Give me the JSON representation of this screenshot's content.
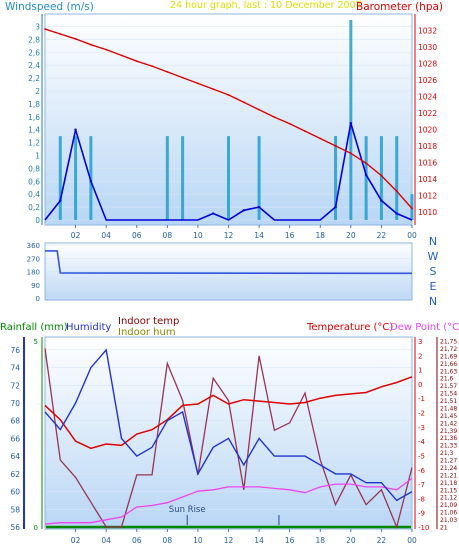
{
  "panel_top": {
    "left_label": "Windspeed (m/s)",
    "center_label": "24 hour graph, last : 10 December 2007",
    "right_label": "Barometer (hpa)",
    "windspeed_ticks": [
      "0",
      "0,2",
      "0,4",
      "0,6",
      "0,8",
      "1",
      "1,2",
      "1,4",
      "1,6",
      "1,8",
      "2",
      "2,2",
      "2,4",
      "2,6",
      "2,8",
      "3"
    ],
    "barometer_ticks": [
      "1010",
      "1012",
      "1014",
      "1016",
      "1018",
      "1020",
      "1022",
      "1024",
      "1026",
      "1028",
      "1030",
      "1032"
    ],
    "colors": {
      "barometer": "#dd0000",
      "gust": "#1f9fcf",
      "speed": "#0000dd",
      "green": "#00aa00"
    }
  },
  "panel_dir": {
    "ticks": [
      "0",
      "90",
      "180",
      "270",
      "360"
    ],
    "compass": [
      "N",
      "W",
      "S",
      "E",
      "N"
    ],
    "color": "#3355dd"
  },
  "panel_bottom": {
    "labels": {
      "rainfall": "Rainfall (mm)",
      "humidity": "Humidity",
      "indoor_temp": "Indoor temp",
      "indoor_hum": "Indoor hum",
      "temperature": "Temperature (°C)",
      "dew_point": "Dew Point (°C)"
    },
    "left_ticks": [
      "58",
      "60",
      "62",
      "64",
      "66",
      "68",
      "70",
      "72",
      "74",
      "76"
    ],
    "rain_ticks": [
      "0",
      "5"
    ],
    "temp_ticks": [
      "-10",
      "-9",
      "-8",
      "-7",
      "-6",
      "-5",
      "-4",
      "-3",
      "-2",
      "-1",
      "0",
      "1",
      "2",
      "3"
    ],
    "indoor_ticks": [
      "21",
      "21,03",
      "21,06",
      "21,09",
      "21,12",
      "21,15",
      "21,18",
      "21,21",
      "21,24",
      "21,27",
      "21,3",
      "21,33",
      "21,36",
      "21,39",
      "21,42",
      "21,45",
      "21,48",
      "21,51",
      "21,54",
      "21,57",
      "21,6",
      "21,63",
      "21,66",
      "21,69",
      "21,72",
      "21,75"
    ],
    "sun_rise_label": "Sun Rise",
    "colors": {
      "rainfall": "#008800",
      "humidity": "#2233cc",
      "indoor_temp": "#880000",
      "indoor_hum": "#888800",
      "temperature": "#dd0000",
      "dew_point": "#ee44ee",
      "indoor_line": "#993355"
    }
  },
  "x_ticks": [
    "02",
    "04",
    "06",
    "08",
    "10",
    "12",
    "14",
    "16",
    "18",
    "20",
    "22",
    "00"
  ],
  "chart_data": [
    {
      "type": "line",
      "title": "24 hour graph, last : 10 December 2007",
      "x": [
        0,
        1,
        2,
        3,
        4,
        5,
        6,
        7,
        8,
        9,
        10,
        11,
        12,
        13,
        14,
        15,
        16,
        17,
        18,
        19,
        20,
        21,
        22,
        23,
        24
      ],
      "series": [
        {
          "name": "Barometer (hpa)",
          "values": [
            1032.2,
            1031.6,
            1031.0,
            1030.3,
            1029.7,
            1029.0,
            1028.3,
            1027.7,
            1027.0,
            1026.3,
            1025.6,
            1024.9,
            1024.2,
            1023.3,
            1022.4,
            1021.5,
            1020.7,
            1019.8,
            1018.9,
            1018.0,
            1017.1,
            1015.9,
            1014.4,
            1012.5,
            1010.4
          ]
        },
        {
          "name": "Windspeed (m/s)",
          "values": [
            0,
            0.3,
            1.4,
            0.6,
            0,
            0,
            0,
            0,
            0,
            0,
            0,
            0.1,
            0,
            0.15,
            0.2,
            0,
            0,
            0,
            0,
            0.2,
            1.5,
            0.7,
            0.3,
            0.1,
            0
          ]
        },
        {
          "name": "Gust (m/s)",
          "values": [
            0,
            1.3,
            1.3,
            1.3,
            0,
            0,
            0,
            0,
            1.3,
            1.3,
            0,
            0,
            1.3,
            0,
            1.3,
            0,
            0,
            0,
            0,
            1.3,
            3.1,
            1.3,
            1.3,
            1.3,
            0.4
          ]
        }
      ],
      "xlabel": "",
      "ylabel": "Windspeed (m/s)",
      "ylim": [
        0,
        3.1
      ],
      "y2lim": [
        1009,
        1033.3
      ]
    },
    {
      "type": "line",
      "x": [
        0,
        0.8,
        1,
        24
      ],
      "series": [
        {
          "name": "",
          "values": [
            320,
            320,
            170,
            168
          ]
        }
      ],
      "ylim": [
        0,
        360
      ]
    },
    {
      "type": "line",
      "x": [
        0,
        1,
        2,
        3,
        4,
        5,
        6,
        7,
        8,
        9,
        10,
        11,
        12,
        13,
        14,
        15,
        16,
        17,
        18,
        19,
        20,
        21,
        22,
        23,
        24
      ],
      "series": [
        {
          "name": "Humidity",
          "values": [
            69,
            67,
            70,
            74,
            76,
            66,
            64,
            65,
            68,
            69,
            62,
            65,
            66,
            63,
            66,
            64,
            64,
            64,
            63,
            62,
            62,
            61,
            61,
            59,
            60
          ]
        },
        {
          "name": "Temperature (°C)",
          "values": [
            -1.5,
            -2.5,
            -4,
            -4.5,
            -4.2,
            -4.3,
            -3.5,
            -3.2,
            -2.5,
            -1.5,
            -1.4,
            -0.8,
            -1.4,
            -1.1,
            -1.2,
            -1.3,
            -1.4,
            -1.3,
            -1.0,
            -0.8,
            -0.7,
            -0.6,
            -0.2,
            0.1,
            0.5
          ]
        },
        {
          "name": "Dew Point (°C)",
          "values": [
            -9.8,
            -9.7,
            -9.7,
            -9.7,
            -9.5,
            -9.3,
            -8.6,
            -8.5,
            -8.3,
            -7.9,
            -7.5,
            -7.4,
            -7.2,
            -7.2,
            -7.2,
            -7.3,
            -7.4,
            -7.6,
            -7.2,
            -7.0,
            -7.0,
            -7.2,
            -7.2,
            -7.4,
            -6.6
          ]
        },
        {
          "name": "Indoor temp",
          "values": [
            21.72,
            21.27,
            21.2,
            21.1,
            21.0,
            21.0,
            21.21,
            21.21,
            21.66,
            21.51,
            21.21,
            21.6,
            21.51,
            21.15,
            21.69,
            21.39,
            21.42,
            21.54,
            21.27,
            21.09,
            21.21,
            21.09,
            21.15,
            21.0,
            21.24
          ]
        }
      ],
      "xlabel": "",
      "ylim": [
        56,
        77
      ]
    }
  ]
}
